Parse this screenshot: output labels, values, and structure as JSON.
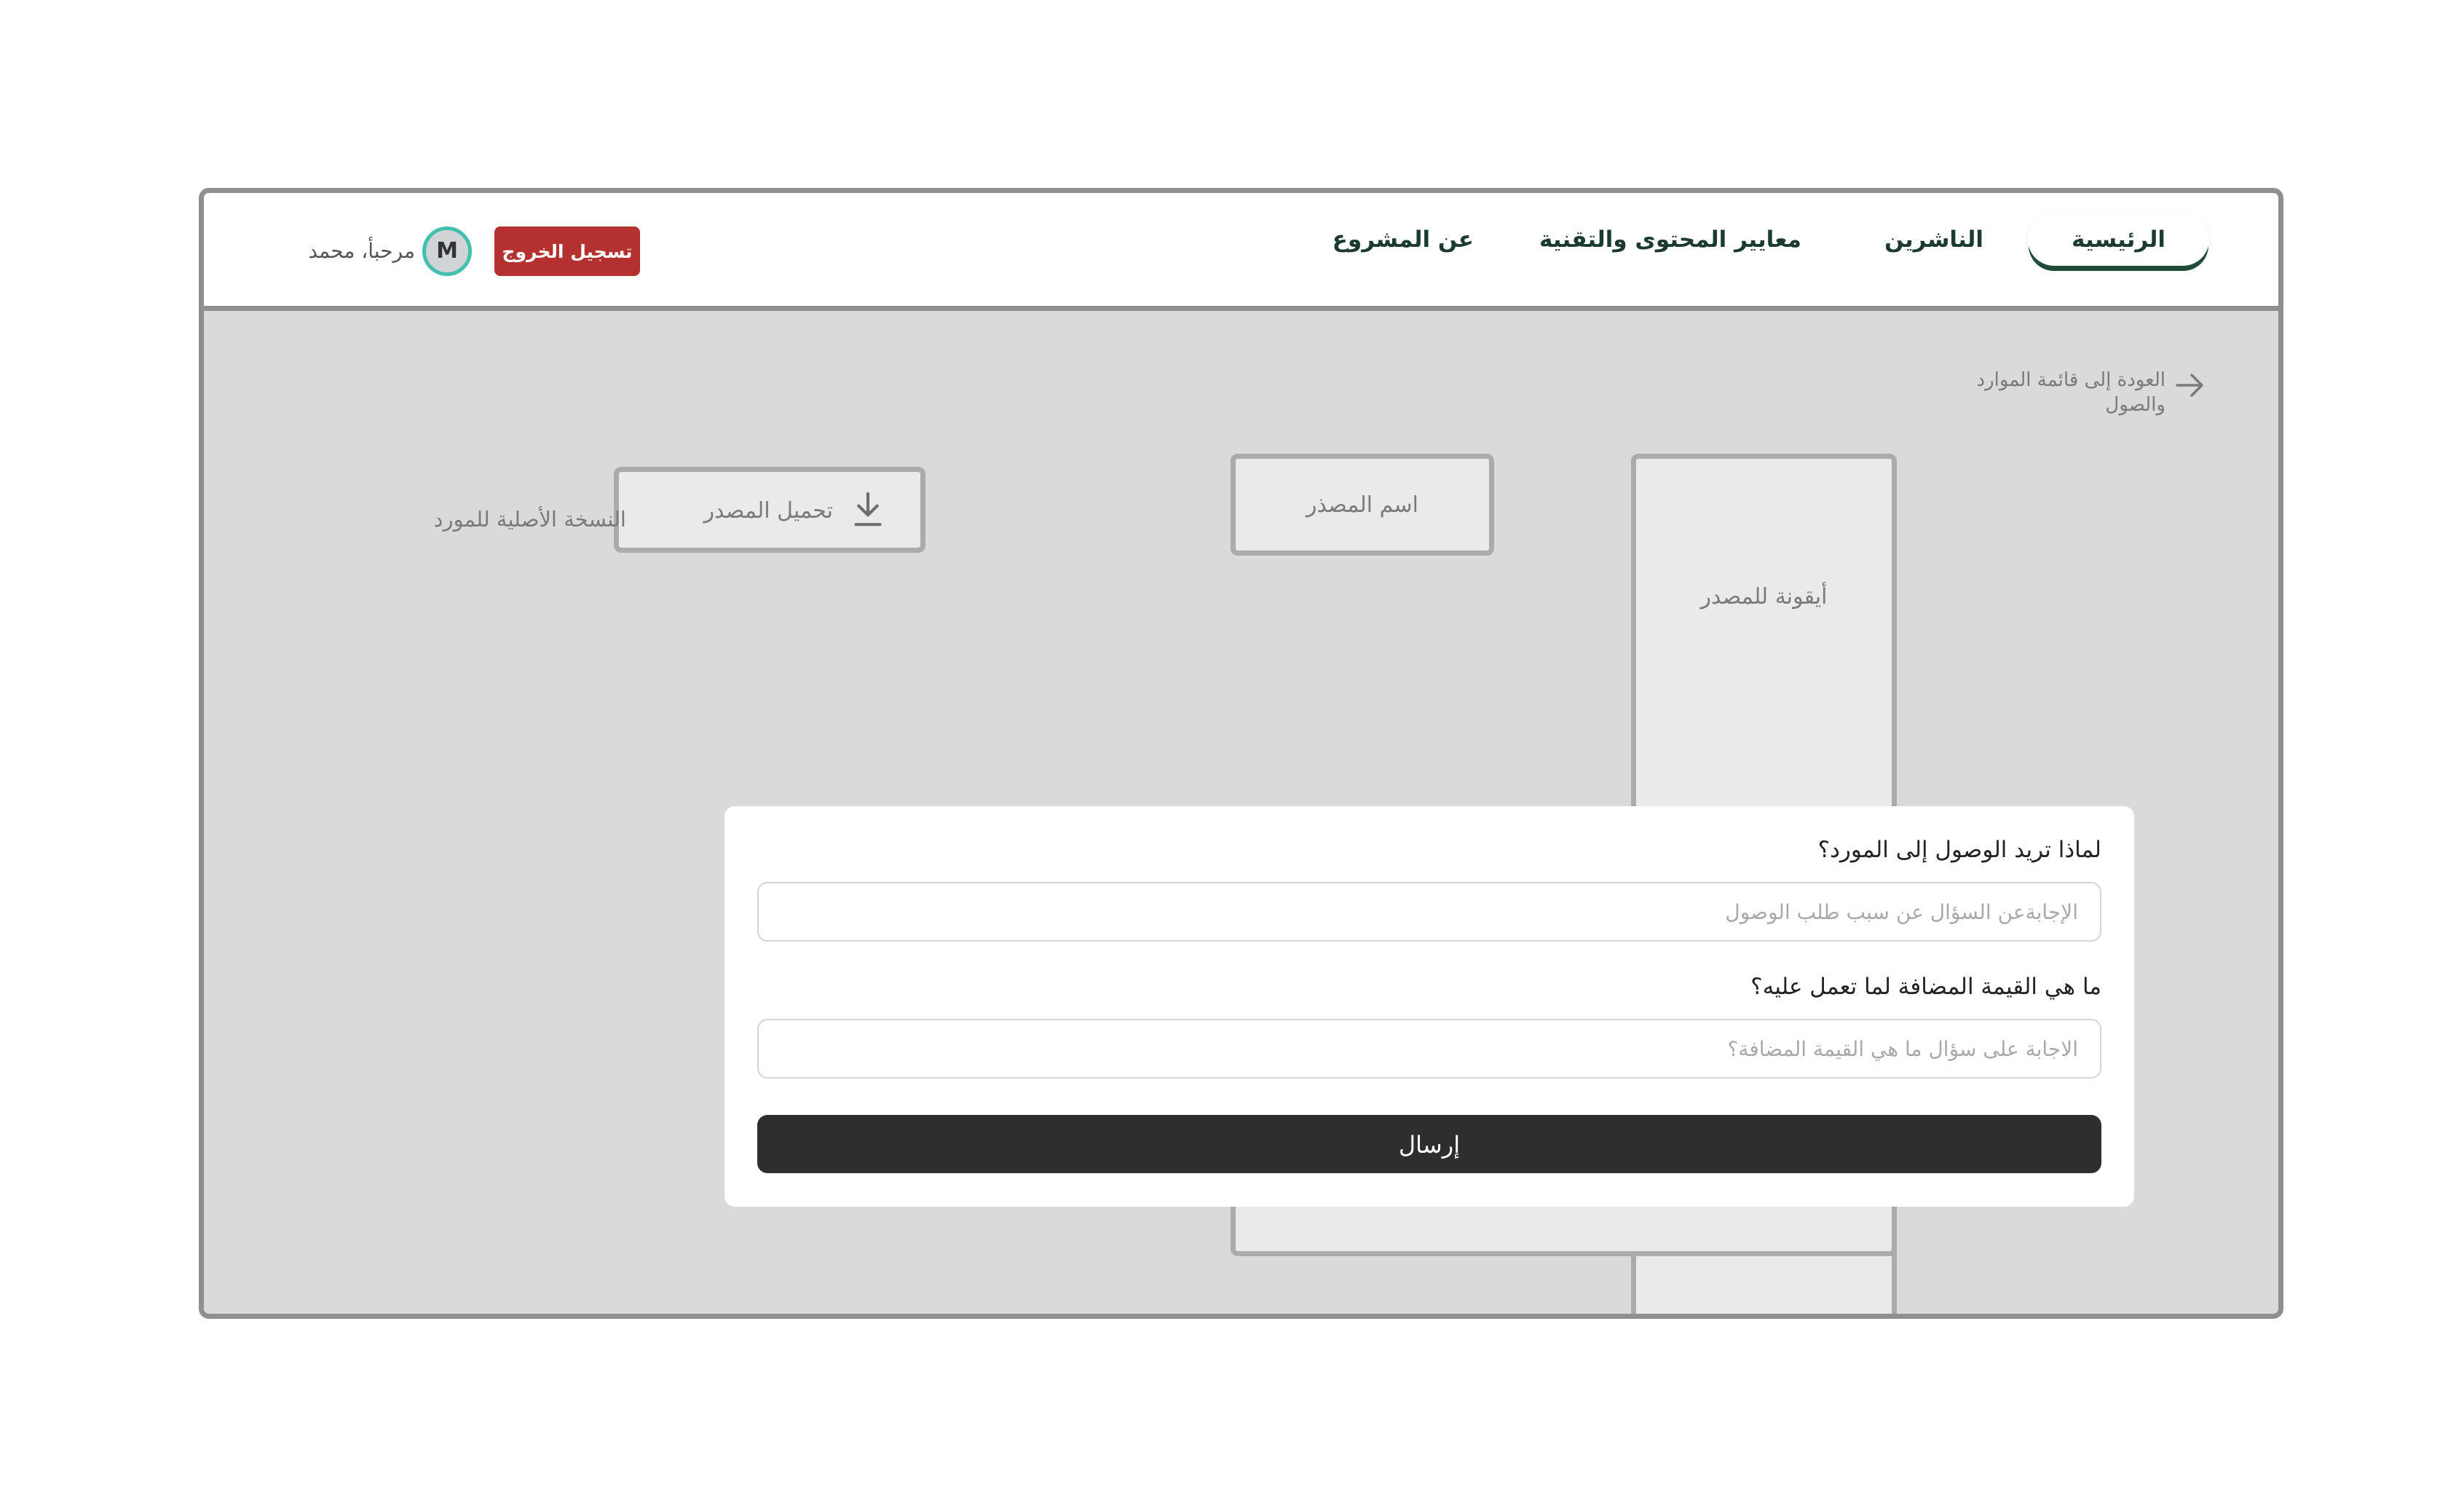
{
  "nav": {
    "items": [
      {
        "label": "الرئيسية",
        "active": true
      },
      {
        "label": "الناشرين",
        "active": false
      },
      {
        "label": "معايير المحتوى والتقنية",
        "active": false
      },
      {
        "label": "عن المشروع",
        "active": false
      }
    ],
    "logout_label": "تسجيل الخروج",
    "avatar_initial": "M",
    "greeting": "مرحبأ، محمد",
    "logout_color": "#b5312f",
    "avatar_ring_color": "#43bfae"
  },
  "page": {
    "back_link_label": "العودة إلى قائمة الموارد والصول",
    "download_label": "تحميل المصدر",
    "original_copy_label": "النسخة الأصلية للمورد",
    "source_name_label": "اسم المصذر",
    "source_icon_label": "أيقونة للمصدر"
  },
  "modal": {
    "q1_label": "لماذا تريد الوصول إلى المورد؟",
    "q1_placeholder": "الإجابةعن السؤال عن سبب طلب الوصول",
    "q1_value": "",
    "q2_label": "ما هي القيمة المضافة لما تعمل عليه؟",
    "q2_placeholder": "الاجابة على سؤال ما هي القيمة المضافة؟",
    "q2_value": "",
    "submit_label": "إرسال"
  },
  "colors": {
    "nav_text": "#1b3a30",
    "overlay": "#dadada",
    "submit_bg": "#2e2e2e"
  }
}
